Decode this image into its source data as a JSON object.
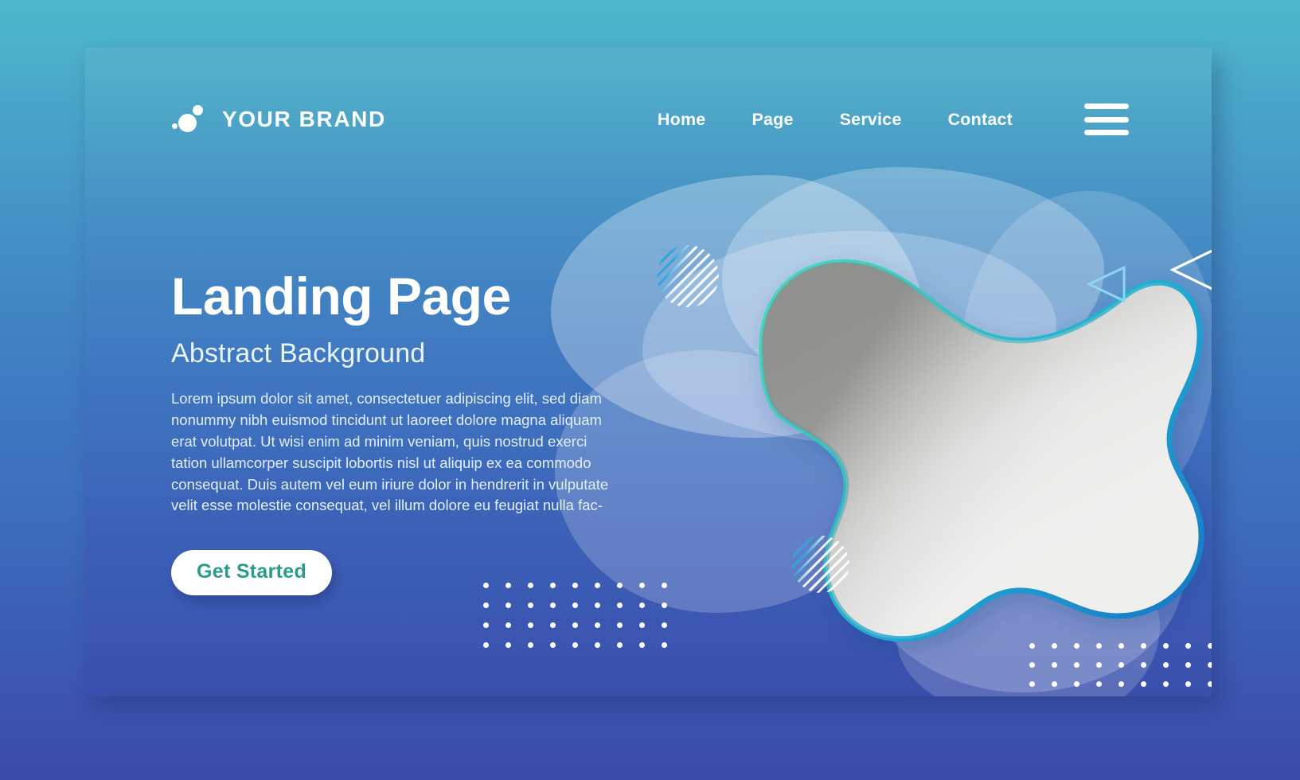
{
  "brand": {
    "name": "YOUR BRAND",
    "logo_icon": "three-circles-icon"
  },
  "nav": {
    "items": [
      {
        "label": "Home"
      },
      {
        "label": "Page"
      },
      {
        "label": "Service"
      },
      {
        "label": "Contact"
      }
    ],
    "menu_icon": "hamburger-menu-icon"
  },
  "hero": {
    "title": "Landing Page",
    "subtitle": "Abstract Background",
    "body": "Lorem ipsum dolor sit amet, consectetuer adipiscing elit, sed diam nonummy nibh euismod tincidunt ut laoreet dolore magna aliquam erat volutpat. Ut wisi enim ad minim veniam, quis nostrud exerci tation ullamcorper suscipit lobortis nisl ut aliquip ex ea commodo consequat. Duis autem vel eum iriure dolor in hendrerit in vulputate velit esse molestie consequat, vel illum dolore eu feugiat nulla fac-",
    "cta_label": "Get Started"
  },
  "colors": {
    "background_top": "#4fb9cc",
    "background_bottom": "#3c4aa9",
    "card_top": "#55b3cb",
    "card_bottom": "#3a4fac",
    "cta_text": "#2a9d8a",
    "cta_background": "#ffffff",
    "blob_outline_start": "#3ecfc0",
    "blob_outline_end": "#1f8fd0",
    "text_primary": "#ffffff",
    "text_body": "#e3eff8"
  },
  "decor": {
    "striped_circles": 2,
    "triangles": 2,
    "dot_grid_columns": 9,
    "dot_grid_rows": 4
  }
}
